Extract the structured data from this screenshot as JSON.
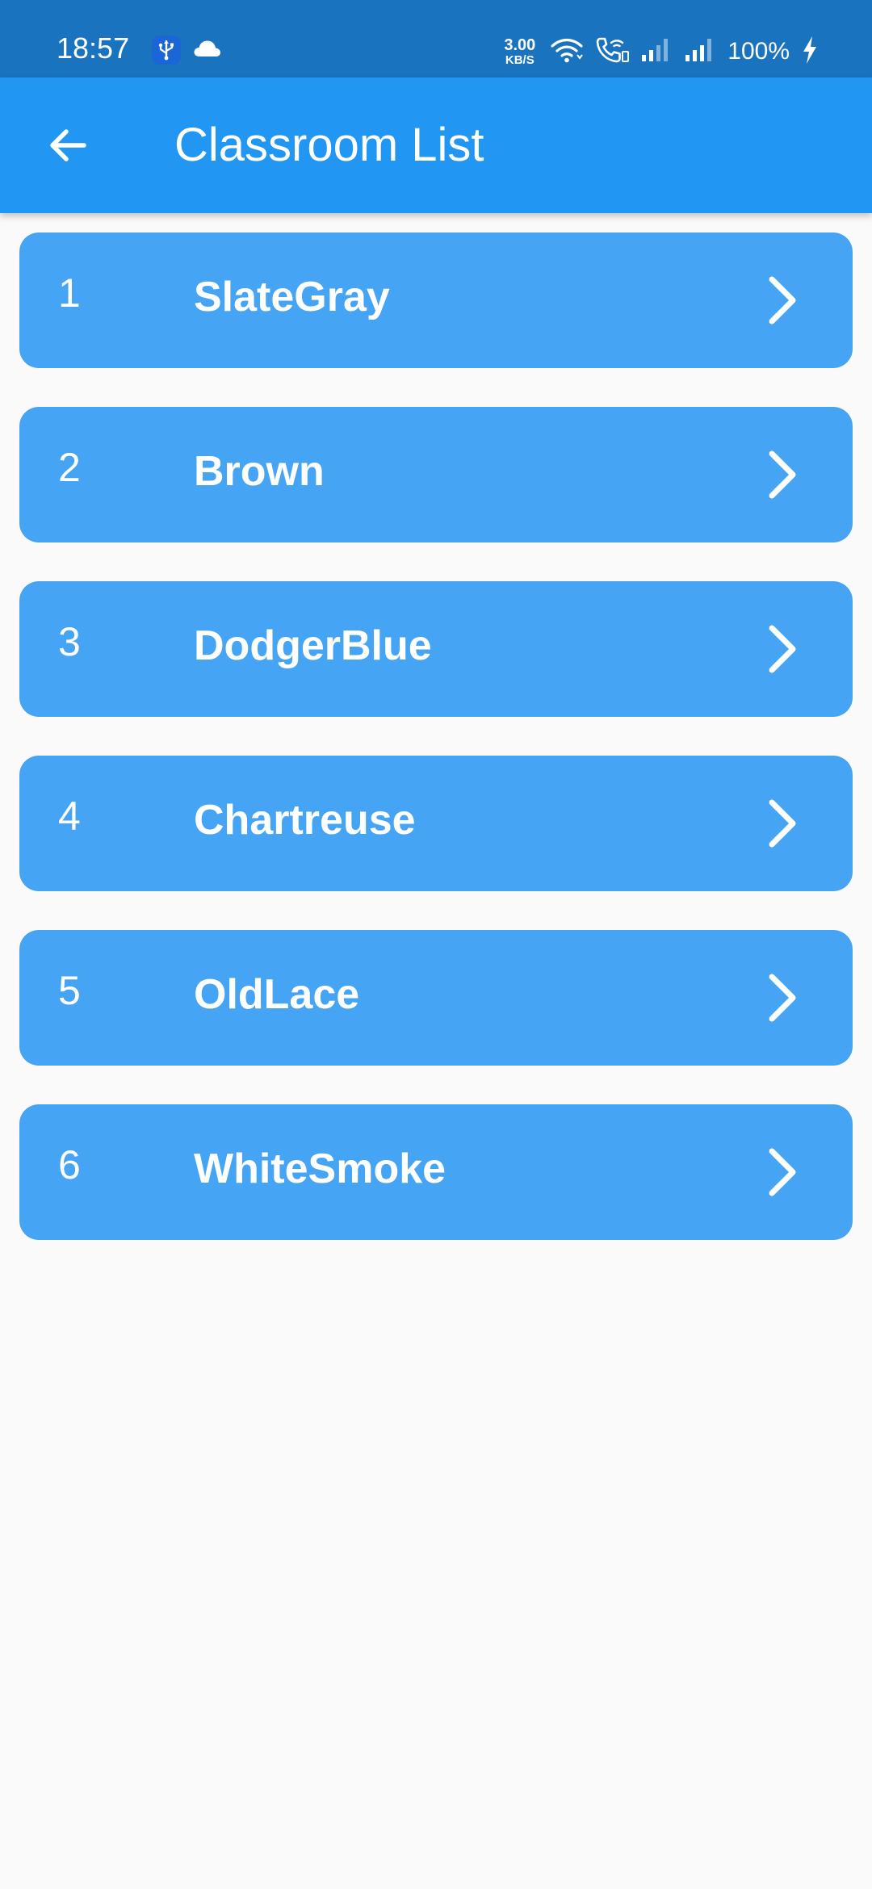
{
  "status_bar": {
    "time": "18:57",
    "net_speed_value": "3.00",
    "net_speed_unit": "KB/S",
    "battery_percent": "100%",
    "icons": [
      "usb-icon",
      "cloud-icon",
      "wifi-icon",
      "wifi-calling-icon",
      "signal-icon",
      "signal-icon",
      "charging-icon"
    ]
  },
  "app_bar": {
    "title": "Classroom List",
    "back_icon": "arrow-back-icon"
  },
  "classrooms": [
    {
      "index": "1",
      "name": "SlateGray"
    },
    {
      "index": "2",
      "name": "Brown"
    },
    {
      "index": "3",
      "name": "DodgerBlue"
    },
    {
      "index": "4",
      "name": "Chartreuse"
    },
    {
      "index": "5",
      "name": "OldLace"
    },
    {
      "index": "6",
      "name": "WhiteSmoke"
    }
  ],
  "colors": {
    "status_bar": "#1A73BE",
    "app_bar": "#2196F3",
    "list_item": "#45A4F4",
    "background": "#FAFAFA",
    "text": "#FFFFFF"
  }
}
